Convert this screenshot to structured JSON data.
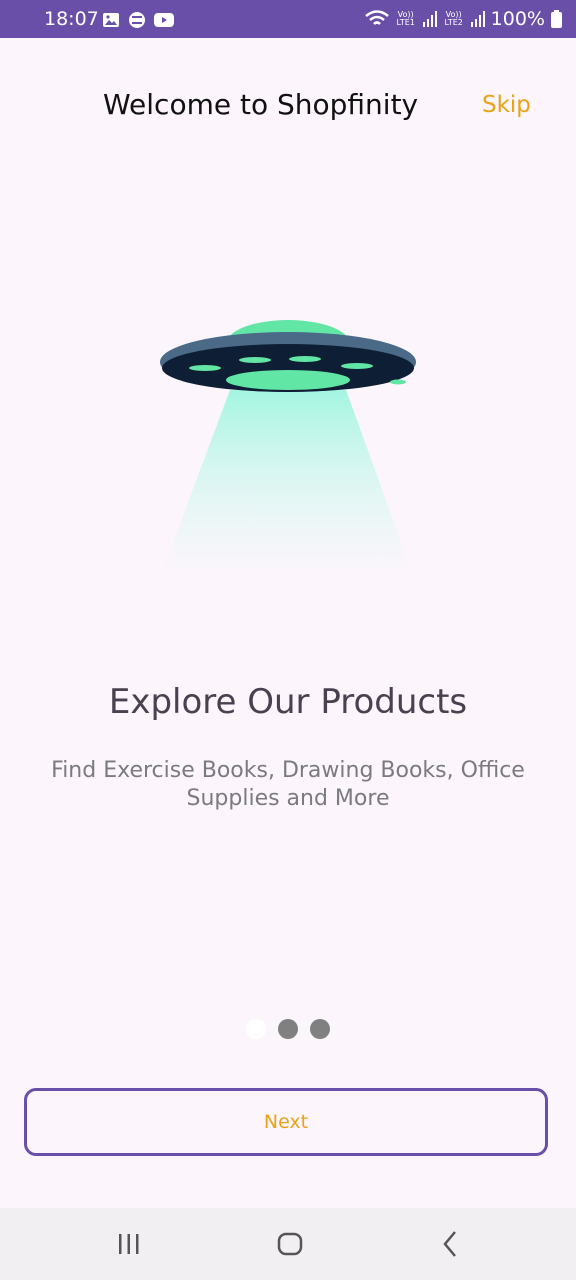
{
  "status_bar": {
    "time": "18:07",
    "sim1_label": "Vo)) LTE1",
    "sim2_label": "Vo)) LTE2",
    "battery": "100%",
    "icons": [
      "gallery-icon",
      "sync-icon",
      "youtube-icon",
      "wifi-icon",
      "signal-icon",
      "battery-icon"
    ],
    "background_color": "#6a4fa8"
  },
  "header": {
    "title": "Welcome to Shopfinity",
    "skip_label": "Skip"
  },
  "onboarding": {
    "headline": "Explore Our Products",
    "description": "Find Exercise Books, Drawing Books, Office Supplies and More",
    "illustration": "ufo-illustration",
    "page_count": 3,
    "current_page": 1
  },
  "actions": {
    "next_label": "Next"
  },
  "navigation_bar": {
    "icons": [
      "recent-apps-icon",
      "home-icon",
      "back-icon"
    ]
  },
  "colors": {
    "accent": "#e8a317",
    "brand": "#6a4fa8",
    "background": "#fcf5fc"
  }
}
